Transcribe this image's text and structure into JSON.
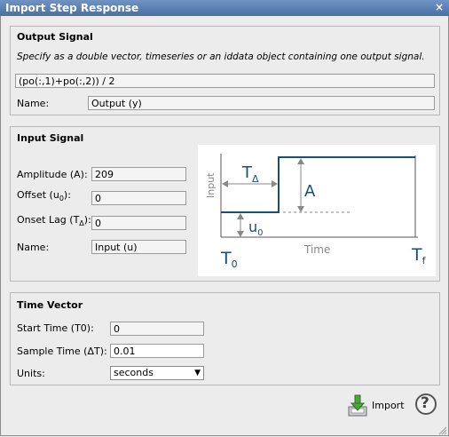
{
  "window": {
    "title": "Import Step Response",
    "close_glyph": "×"
  },
  "output_signal": {
    "heading": "Output Signal",
    "description": "Specify as a double vector, timeseries or an iddata object containing one output signal.",
    "expression": "(po(:,1)+po(:,2)) / 2",
    "name_label": "Name:",
    "name_value": "Output (y)"
  },
  "input_signal": {
    "heading": "Input Signal",
    "amplitude_label": "Amplitude (A):",
    "amplitude_value": "209",
    "offset_label_main": "Offset (u",
    "offset_label_sub": "0",
    "offset_label_end": "):",
    "offset_value": "0",
    "onset_label_main": "Onset Lag (T",
    "onset_label_sub": "Δ",
    "onset_label_end": "):",
    "onset_value": "0",
    "name_label": "Name:",
    "name_value": "Input (u)"
  },
  "diagram": {
    "y_axis_label": "Input",
    "x_axis_label": "Time",
    "t_delta_main": "T",
    "t_delta_sub": "Δ",
    "amplitude_mark": "A",
    "u0_main": "u",
    "u0_sub": "0",
    "t0_main": "T",
    "t0_sub": "0",
    "tf_main": "T",
    "tf_sub": "f",
    "line_color": "#1a4e7a",
    "annotation_color": "#888888"
  },
  "time_vector": {
    "heading": "Time Vector",
    "start_label": "Start Time (T0):",
    "start_value": "0",
    "sample_label": "Sample Time (ΔT):",
    "sample_value": "0.01",
    "units_label": "Units:",
    "units_value": "seconds"
  },
  "actions": {
    "import_label": "Import",
    "help_glyph": "?"
  }
}
